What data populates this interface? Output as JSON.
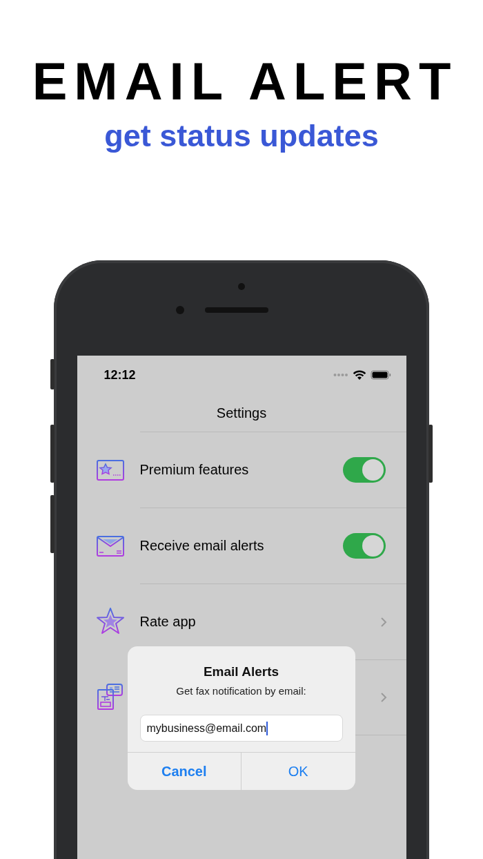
{
  "headline": "EMAIL ALERT",
  "subtitle": "get status updates",
  "status_bar": {
    "time": "12:12"
  },
  "nav": {
    "title": "Settings"
  },
  "rows": [
    {
      "kind": "toggle",
      "label": "Premium features",
      "on": true
    },
    {
      "kind": "toggle",
      "label": "Receive email alerts",
      "on": true
    },
    {
      "kind": "link",
      "label": "Rate app"
    },
    {
      "kind": "link"
    }
  ],
  "dialog": {
    "title": "Email Alerts",
    "message": "Get fax notification by email:",
    "value": "mybusiness@email.com",
    "buttons": [
      {
        "label": "Cancel",
        "kind": "cancel"
      },
      {
        "label": "OK",
        "kind": "default"
      }
    ]
  }
}
